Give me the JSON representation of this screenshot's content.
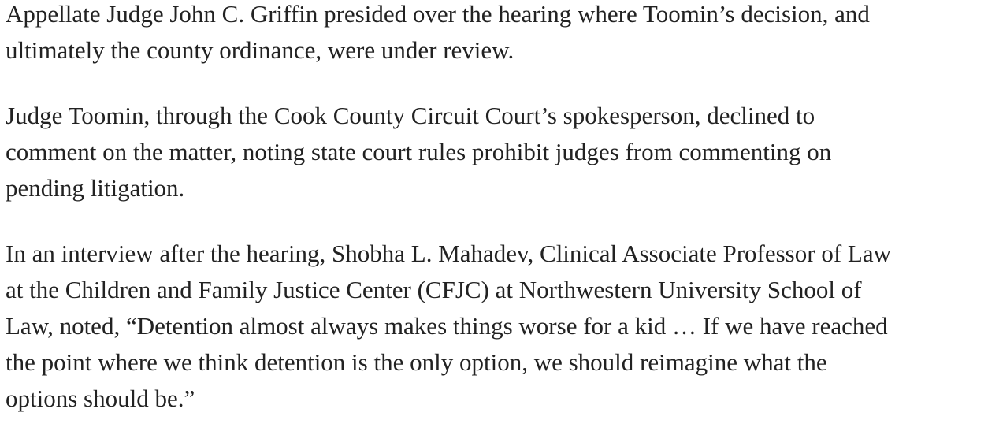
{
  "article": {
    "paragraphs": [
      {
        "lines": [
          "Appellate Judge John C. Griffin presided over the hearing where Toomin’s decision, and",
          "ultimately the county ordinance, were under review."
        ]
      },
      {
        "lines": [
          "Judge Toomin, through the Cook County Circuit Court’s spokesperson, declined to",
          "comment on the matter, noting state court rules prohibit judges from commenting on",
          "pending litigation."
        ]
      },
      {
        "lines": [
          "In an interview after the hearing, Shobha L. Mahadev, Clinical Associate Professor of Law",
          "at the Children and Family Justice Center (CFJC) at Northwestern University School of",
          "Law, noted, “Detention almost always makes things worse for a kid … If we have reached",
          "the point where we think detention is the only option, we should reimagine what the",
          "options should be.”"
        ]
      }
    ]
  }
}
